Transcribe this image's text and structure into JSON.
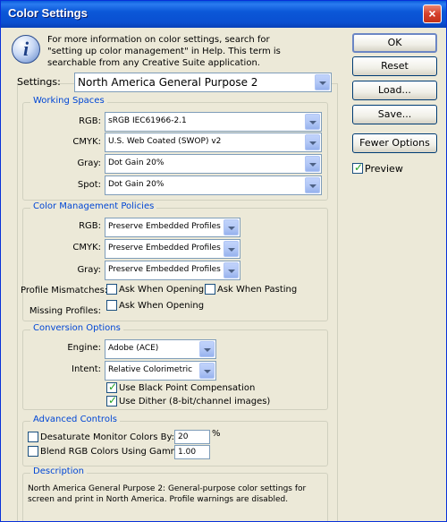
{
  "window": {
    "title": "Color Settings",
    "close_glyph": "×"
  },
  "info": {
    "icon": "info-icon",
    "text": "For more information on color settings, search for \"setting up color management\" in Help. This term is searchable from any Creative Suite application."
  },
  "buttons": {
    "ok": "OK",
    "reset": "Reset",
    "load": "Load...",
    "save": "Save...",
    "fewer": "Fewer Options"
  },
  "preview": {
    "label": "Preview",
    "checked": true
  },
  "settings": {
    "label": "Settings:",
    "value": "North America General Purpose 2"
  },
  "working_spaces": {
    "title": "Working Spaces",
    "rgb": {
      "label": "RGB:",
      "value": "sRGB IEC61966-2.1"
    },
    "cmyk": {
      "label": "CMYK:",
      "value": "U.S. Web Coated (SWOP) v2"
    },
    "gray": {
      "label": "Gray:",
      "value": "Dot Gain 20%"
    },
    "spot": {
      "label": "Spot:",
      "value": "Dot Gain 20%"
    }
  },
  "policies": {
    "title": "Color Management Policies",
    "rgb": {
      "label": "RGB:",
      "value": "Preserve Embedded Profiles"
    },
    "cmyk": {
      "label": "CMYK:",
      "value": "Preserve Embedded Profiles"
    },
    "gray": {
      "label": "Gray:",
      "value": "Preserve Embedded Profiles"
    },
    "mismatches_label": "Profile Mismatches:",
    "ask_opening": "Ask When Opening",
    "ask_pasting": "Ask When Pasting",
    "missing_label": "Missing Profiles:",
    "missing_ask_opening": "Ask When Opening"
  },
  "conversion": {
    "title": "Conversion Options",
    "engine": {
      "label": "Engine:",
      "value": "Adobe (ACE)"
    },
    "intent": {
      "label": "Intent:",
      "value": "Relative Colorimetric"
    },
    "black_point": "Use Black Point Compensation",
    "dither": "Use Dither (8-bit/channel images)"
  },
  "advanced": {
    "title": "Advanced Controls",
    "desaturate": {
      "label": "Desaturate Monitor Colors By:",
      "value": "20",
      "unit": "%"
    },
    "blend": {
      "label": "Blend RGB Colors Using Gamma:",
      "value": "1.00"
    }
  },
  "description": {
    "title": "Description",
    "text": "North America General Purpose 2:  General-purpose color settings for screen and print in North America. Profile warnings are disabled."
  }
}
